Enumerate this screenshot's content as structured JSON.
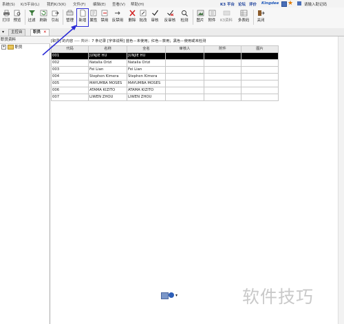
{
  "menubar": {
    "items": [
      "系统(S)",
      "K/3平台(L)",
      "我的K/3(K)",
      "文件(F)",
      "编辑(E)",
      "查看(V)",
      "帮助(H)"
    ],
    "links": [
      "K3 平台",
      "论坛",
      "评价"
    ],
    "brand": "Kingdee",
    "search_placeholder": "请输入助记码"
  },
  "toolbar": {
    "buttons": [
      {
        "label": "打印",
        "icon": "printer-icon"
      },
      {
        "label": "预览",
        "icon": "preview-icon"
      },
      {
        "label": "过滤",
        "icon": "filter-icon"
      },
      {
        "label": "刷新",
        "icon": "refresh-icon"
      },
      {
        "label": "引出",
        "icon": "export-icon"
      },
      {
        "label": "管理",
        "icon": "manage-icon"
      },
      {
        "label": "新增",
        "icon": "new-document-icon"
      },
      {
        "label": "属性",
        "icon": "properties-icon"
      },
      {
        "label": "禁用",
        "icon": "disable-icon"
      },
      {
        "label": "反禁用",
        "icon": "enable-icon"
      },
      {
        "label": "删除",
        "icon": "delete-icon"
      },
      {
        "label": "批改",
        "icon": "batch-edit-icon"
      },
      {
        "label": "审核",
        "icon": "audit-icon"
      },
      {
        "label": "反审核",
        "icon": "unaudit-icon"
      },
      {
        "label": "检测",
        "icon": "check-icon"
      },
      {
        "label": "图片",
        "icon": "picture-icon"
      },
      {
        "label": "附件",
        "icon": "attachment-icon"
      },
      {
        "label": "K3资料",
        "icon": "k3-data-icon"
      },
      {
        "label": "多表码",
        "icon": "multi-table-icon"
      },
      {
        "label": "关闭",
        "icon": "close-icon"
      }
    ],
    "highlighted": "新增"
  },
  "tabs": [
    {
      "label": "主控台"
    },
    {
      "label": "职员"
    }
  ],
  "left_panel": {
    "header": "职员资料",
    "tree_root": "职员"
  },
  "infobar": {
    "text": "[职员] 的内容 ---- 共计：7 条记录  [字体说明] 蓝色－未使用；红色－禁用；黑色－使用或未检测"
  },
  "grid": {
    "columns": [
      "代码",
      "名称",
      "全名",
      "审核人",
      "附件",
      "图片"
    ],
    "rows": [
      [
        "001",
        "JUNJIE HU",
        "JUNJIE HU",
        "",
        "",
        ""
      ],
      [
        "002",
        "Natalia Orizi",
        "Natalia Orizi",
        "",
        "",
        ""
      ],
      [
        "003",
        "Fei Lian",
        "Fei Lian",
        "",
        "",
        ""
      ],
      [
        "004",
        "Stephen Kimera",
        "Stephen Kimera",
        "",
        "",
        ""
      ],
      [
        "005",
        "MAYUMBA MOSES",
        "MAYUMBA MOSES",
        "",
        "",
        ""
      ],
      [
        "006",
        "ATAMA KIZITO",
        "ATAMA KIZITO",
        "",
        "",
        ""
      ],
      [
        "007",
        "LIWEN ZHOU",
        "LIWEN ZHOU",
        "",
        "",
        ""
      ]
    ],
    "selected_row": 0
  },
  "watermark": "软件技巧",
  "colors": {
    "highlight_box": "#2b2bd6",
    "arrow": "#2b2bd6",
    "selected_row_bg": "#000000"
  }
}
